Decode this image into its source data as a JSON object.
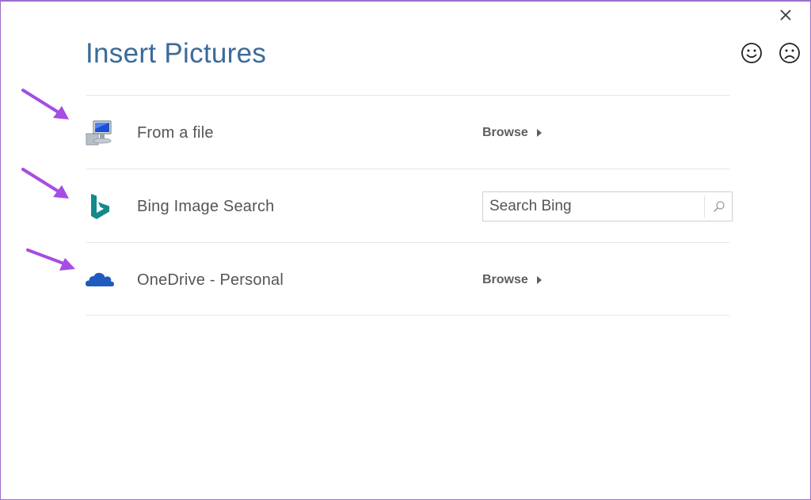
{
  "dialog": {
    "title": "Insert Pictures",
    "close_icon": "close-icon",
    "feedback": {
      "smile_icon": "smile-icon",
      "frown_icon": "frown-icon"
    },
    "rows": [
      {
        "label": "From a file",
        "icon": "monitor-icon",
        "action": "Browse",
        "action_icon": "caret-right-icon"
      },
      {
        "label": "Bing Image Search",
        "icon": "bing-logo-icon",
        "search": {
          "placeholder": "Search Bing",
          "value": "",
          "icon": "search-icon"
        }
      },
      {
        "label": "OneDrive - Personal",
        "icon": "onedrive-cloud-icon",
        "action": "Browse",
        "action_icon": "caret-right-icon"
      }
    ]
  },
  "annotations": {
    "arrow_icon": "arrow-icon",
    "color": "#a64de3"
  },
  "colors": {
    "title": "#3c6a9a",
    "border": "#9b6fc9",
    "divider": "#e6e6e6",
    "bing": "#138a8a",
    "onedrive": "#1f5bbf"
  }
}
